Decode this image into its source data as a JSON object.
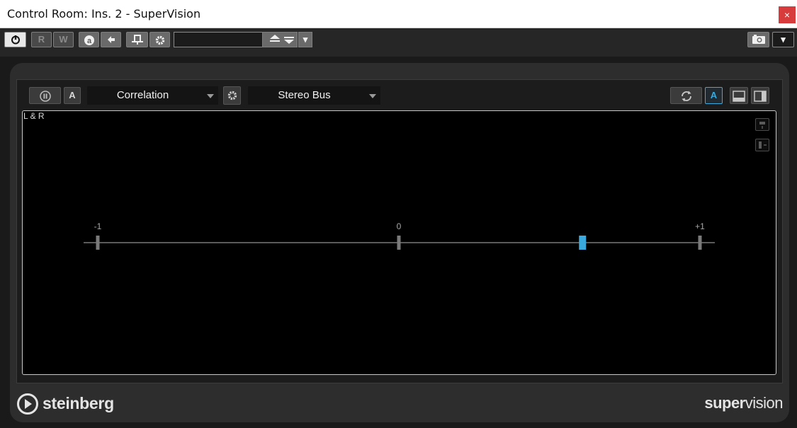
{
  "window": {
    "title": "Control Room: Ins. 2 - SuperVision",
    "close_icon": "×"
  },
  "host_toolbar": {
    "power_icon": "power-icon",
    "read_label": "R",
    "write_label": "W",
    "auto_label": "a",
    "preset_value": "",
    "menu_arrow": "▾"
  },
  "plugin": {
    "auto_label": "A",
    "module": "Correlation",
    "bus": "Stereo Bus",
    "link_label": "A",
    "channel_label": "L & R",
    "accent_color": "#3aa9dd"
  },
  "chart_data": {
    "type": "scatter",
    "title": "",
    "xlabel": "",
    "ylabel": "",
    "xlim": [
      -1,
      1
    ],
    "tick_labels": [
      "-1",
      "0",
      "+1"
    ],
    "ticks": [
      -1,
      0,
      1
    ],
    "series": [
      {
        "values": [
          {
            "x": 0.61
          }
        ]
      }
    ]
  },
  "footer": {
    "brand": "steinberg",
    "product_a": "super",
    "product_b": "vision"
  }
}
